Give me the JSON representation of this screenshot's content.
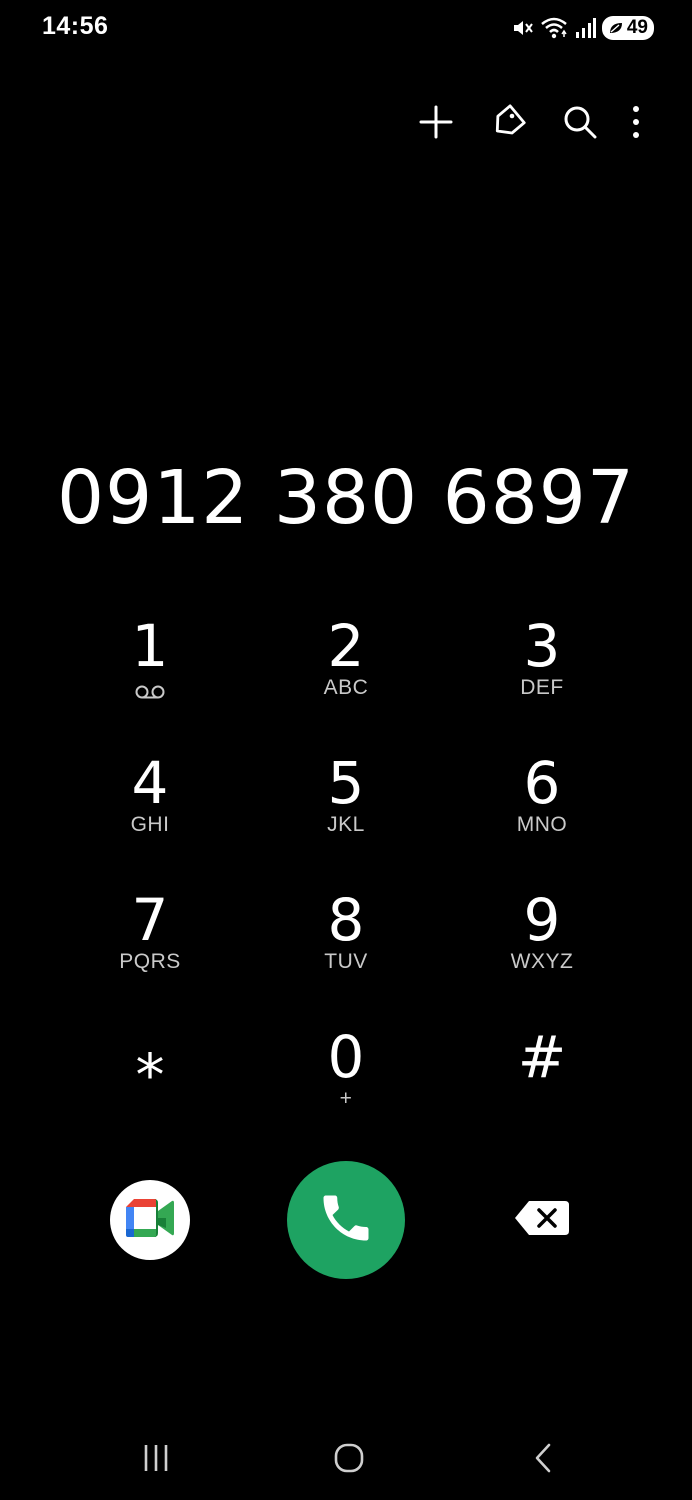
{
  "status_bar": {
    "time": "14:56",
    "battery_level": "49",
    "icons": [
      "mute-icon",
      "wifi-icon",
      "signal-icon",
      "battery-icon"
    ]
  },
  "toolbar": {
    "icons": [
      "plus-icon",
      "tag-icon",
      "search-icon",
      "more-vertical-icon"
    ]
  },
  "dialer": {
    "number": "0912 380 6897"
  },
  "keypad": {
    "keys": [
      {
        "digit": "1",
        "letters": "",
        "sub_icon": "voicemail-icon"
      },
      {
        "digit": "2",
        "letters": "ABC"
      },
      {
        "digit": "3",
        "letters": "DEF"
      },
      {
        "digit": "4",
        "letters": "GHI"
      },
      {
        "digit": "5",
        "letters": "JKL"
      },
      {
        "digit": "6",
        "letters": "MNO"
      },
      {
        "digit": "7",
        "letters": "PQRS"
      },
      {
        "digit": "8",
        "letters": "TUV"
      },
      {
        "digit": "9",
        "letters": "WXYZ"
      },
      {
        "digit": "⁎",
        "letters": ""
      },
      {
        "digit": "0",
        "letters": "+"
      },
      {
        "digit": "#",
        "letters": ""
      }
    ]
  },
  "actions": {
    "video_call_icon": "google-meet-icon",
    "call_icon": "phone-icon",
    "backspace_icon": "backspace-icon",
    "call_color": "#1ea362"
  },
  "nav_bar": {
    "icons": [
      "recents-icon",
      "home-icon",
      "back-icon"
    ]
  }
}
